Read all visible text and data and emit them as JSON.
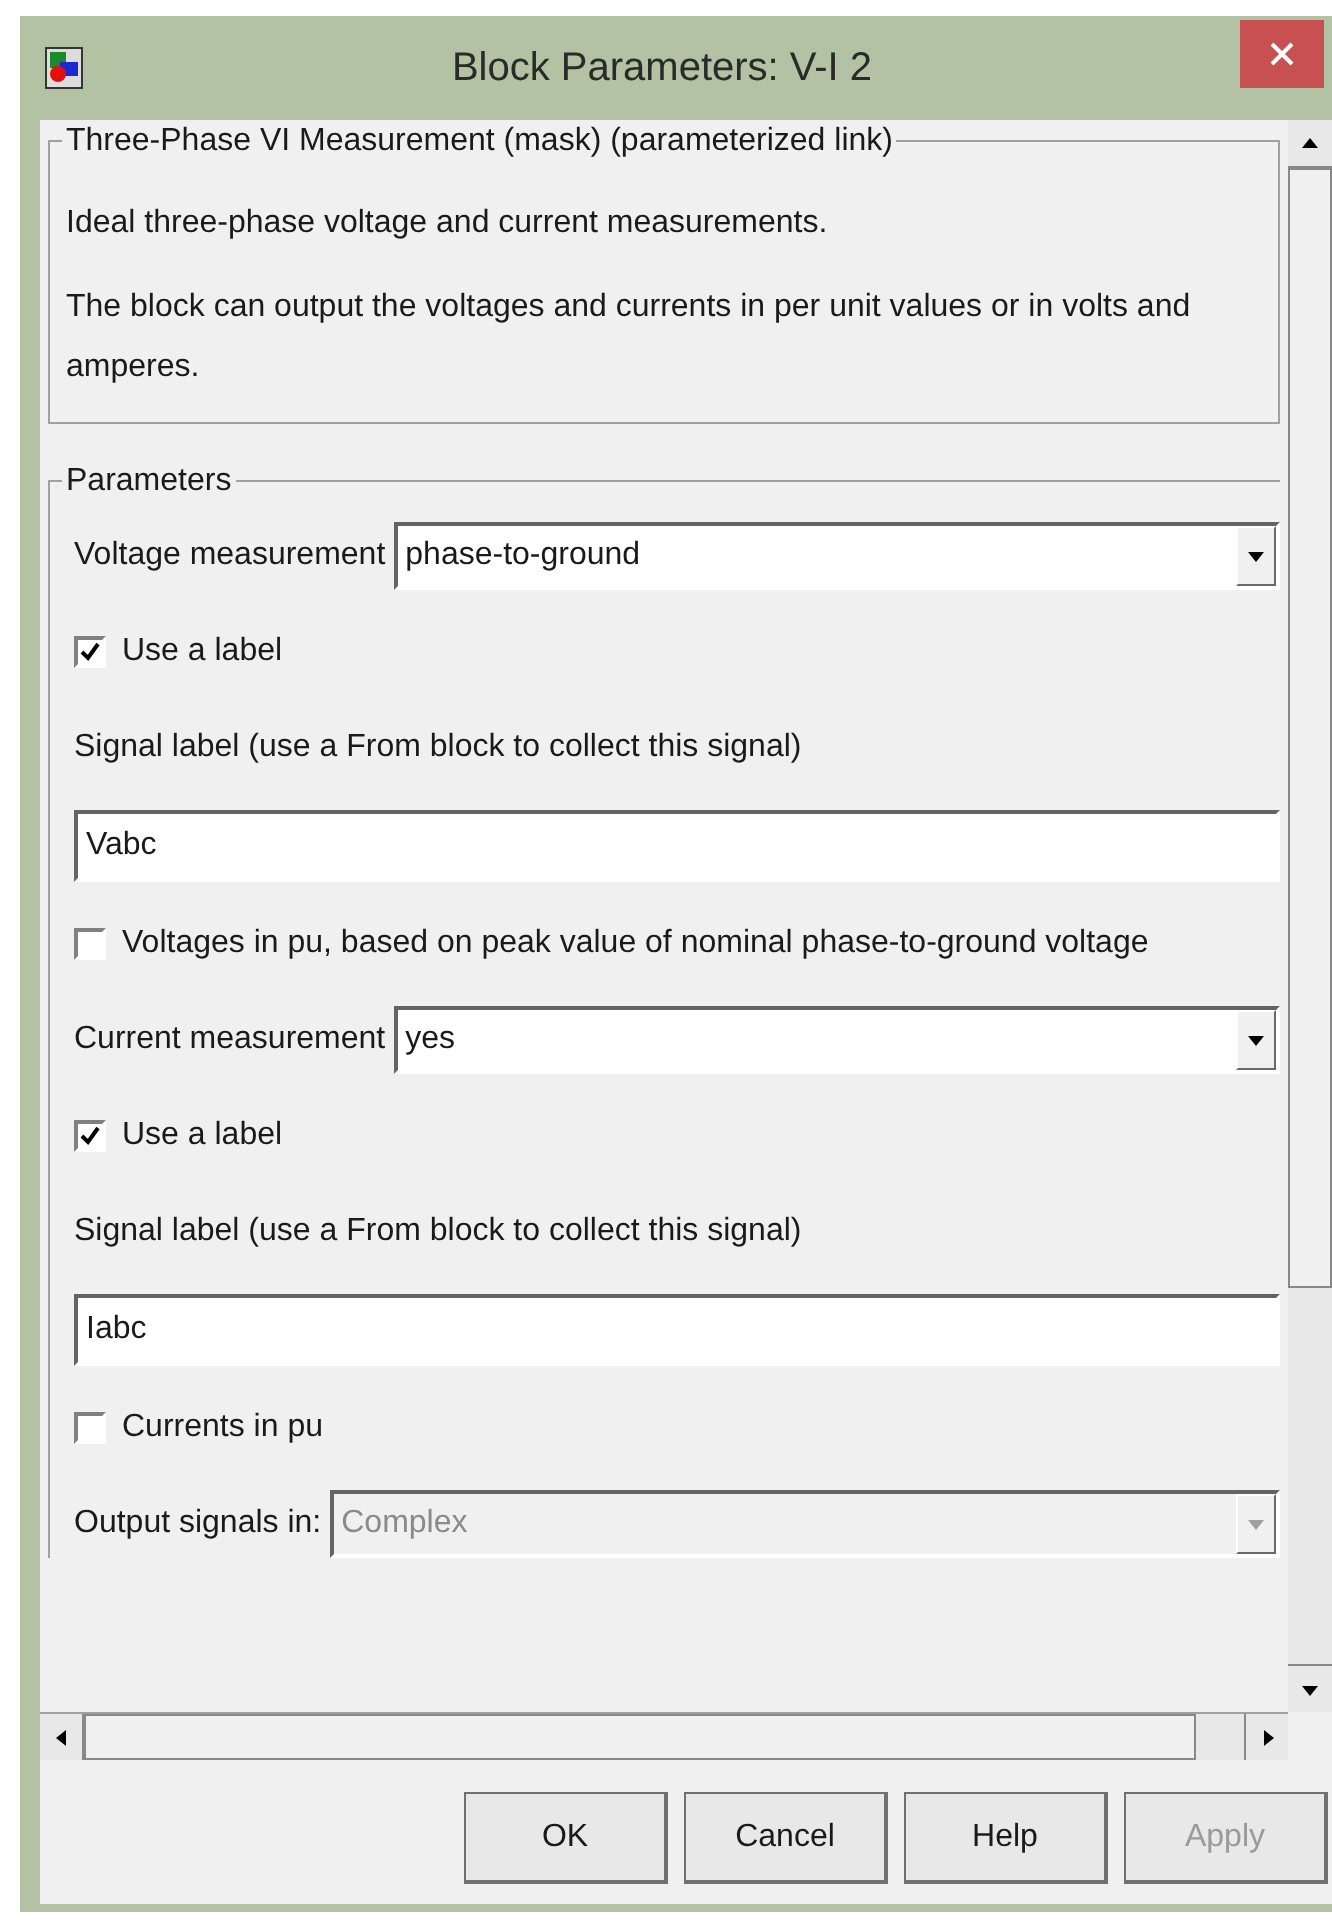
{
  "window": {
    "title": "Block Parameters: V-I 2"
  },
  "description": {
    "title": "Three-Phase VI Measurement (mask) (parameterized link)",
    "paragraphs": [
      "Ideal three-phase voltage and current measurements.",
      "The block can output the voltages and currents in per unit values or in volts and amperes."
    ]
  },
  "parameters": {
    "title": "Parameters",
    "items": [
      {
        "kind": "dropdown",
        "label": "Voltage measurement",
        "value": "phase-to-ground",
        "disabled": false
      },
      {
        "kind": "checkbox",
        "label": "Use a label",
        "checked": true
      },
      {
        "kind": "text",
        "label": "Signal label  (use a From block to collect this signal)"
      },
      {
        "kind": "textbox",
        "value": "Vabc"
      },
      {
        "kind": "checkbox",
        "label": "Voltages in pu,  based on peak value of nominal phase-to-ground voltage",
        "checked": false
      },
      {
        "kind": "dropdown",
        "label": "Current measurement",
        "value": "yes",
        "disabled": false
      },
      {
        "kind": "checkbox",
        "label": "Use a label",
        "checked": true
      },
      {
        "kind": "text",
        "label": "Signal label  (use a From block to collect this signal)"
      },
      {
        "kind": "textbox",
        "value": "Iabc"
      },
      {
        "kind": "checkbox",
        "label": "Currents in pu",
        "checked": false
      },
      {
        "kind": "dropdown",
        "label": "Output signals in:",
        "value": "Complex",
        "disabled": true
      }
    ]
  },
  "buttons": [
    {
      "label": "OK",
      "disabled": false
    },
    {
      "label": "Cancel",
      "disabled": false
    },
    {
      "label": "Help",
      "disabled": false
    },
    {
      "label": "Apply",
      "disabled": true
    }
  ]
}
